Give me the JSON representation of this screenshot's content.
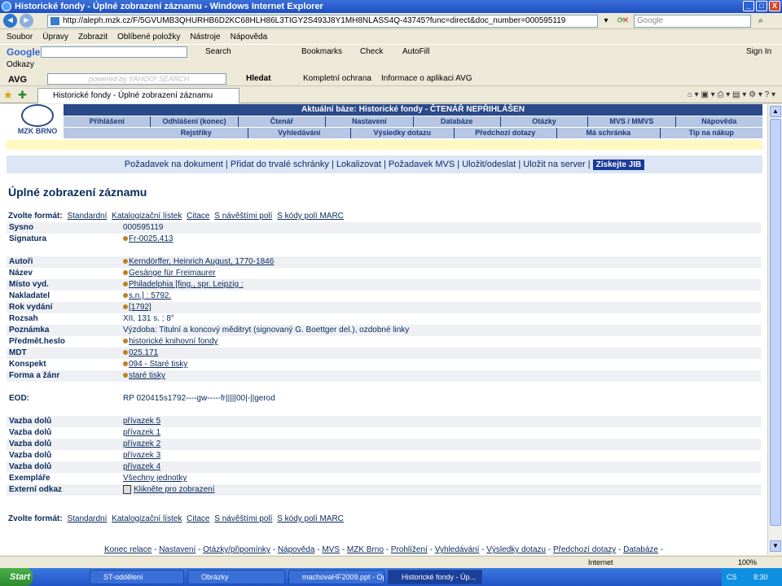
{
  "window": {
    "title": "Historické fondy - Úplné zobrazení záznamu - Windows Internet Explorer",
    "min": "_",
    "max": "□",
    "close": "X"
  },
  "address": {
    "url": "http://aleph.mzk.cz/F/5GVUMB3QHURHB6D2KC68HLH86L3TIGY2S493J8Y1MH8NLASS4Q-43745?func=direct&doc_number=000595119",
    "search_placeholder": "Google"
  },
  "menu": [
    "Soubor",
    "Úpravy",
    "Zobrazit",
    "Oblíbené položky",
    "Nástroje",
    "Nápověda"
  ],
  "google_toolbar": {
    "logo": "Google",
    "search_label": "Search",
    "bookmarks": "Bookmarks",
    "check": "Check",
    "autofill": "AutoFill",
    "signin": "Sign In"
  },
  "links_bar": "Odkazy",
  "avg_toolbar": {
    "logo": "AVG",
    "search_placeholder": "powered by YAHOO! SEARCH",
    "hledat": "Hledat",
    "kompletni": "Kompletní ochrana",
    "informace": "Informace o aplikaci AVG"
  },
  "tab": {
    "title": "Historické fondy - Úplné zobrazení záznamu"
  },
  "site": {
    "logo_text": "MZK BRNO",
    "bases_title": "Aktuální báze: Historické fondy - ČTENÁŘ NEPŘIHLÁŠEN",
    "nav1": [
      "Přihlášení",
      "Odhlášení (konec)",
      "Čtenář",
      "Nastavení",
      "Databáze",
      "Otázky",
      "MVS / MMVS",
      "Nápověda"
    ],
    "nav2": [
      "Rejstříky",
      "Vyhledávání",
      "Výsledky dotazu",
      "Předchozí dotazy",
      "Má schránka",
      "Tip na nákup"
    ],
    "actions": [
      "Požadavek na dokument",
      "Přidat do trvalé schránky",
      "Lokalizovat",
      "Požadavek MVS",
      "Uložit/odeslat",
      "Uložit na server"
    ],
    "jib": "Získejte JIB",
    "heading": "Úplné zobrazení záznamu",
    "format_label": "Zvolte formát:",
    "formats": [
      "Standardní",
      "Katalogizační lístek",
      "Citace",
      "S návěštími polí",
      "S kódy polí MARC"
    ]
  },
  "record": [
    {
      "label": "Sysno",
      "value": "000595119",
      "link": false,
      "dot": false
    },
    {
      "label": "Signatura",
      "value": "Fr-0025.413",
      "link": true,
      "dot": true
    },
    {
      "gap": true
    },
    {
      "label": "Autoři",
      "value": "Kerndörffer, Heinrich August, 1770-1846",
      "link": true,
      "dot": true
    },
    {
      "label": "Název",
      "value": "Gesänge für Freimaurer",
      "link": true,
      "dot": true
    },
    {
      "label": "Místo vyd.",
      "value": "Philadelphia [fing., spr. Leipzig :",
      "link": true,
      "dot": true
    },
    {
      "label": "Nakladatel",
      "value": "s.n.] : 5792.",
      "link": true,
      "dot": true
    },
    {
      "label": "Rok vydání",
      "value": "[1792]",
      "link": true,
      "dot": true
    },
    {
      "label": "Rozsah",
      "value": "XII, 131 s. ; 8°",
      "link": false,
      "dot": false
    },
    {
      "label": "Poznámka",
      "value": "Výzdoba: Titulní a koncový měditryt (signovaný G. Boettger del.), ozdobné linky",
      "link": false,
      "dot": false
    },
    {
      "label": "Předmět.heslo",
      "value": "historické knihovní fondy",
      "link": true,
      "dot": true
    },
    {
      "label": "MDT",
      "value": "025.171",
      "link": true,
      "dot": true
    },
    {
      "label": "Konspekt",
      "value": "094 - Staré tisky",
      "link": true,
      "dot": true
    },
    {
      "label": "Forma a žánr",
      "value": "staré tisky",
      "link": true,
      "dot": true
    },
    {
      "gap": true
    },
    {
      "label": "EOD:",
      "value": "RP 020415s1792----gw-----fr|||||00|-||gerod",
      "link": false,
      "dot": false
    },
    {
      "gap": true
    },
    {
      "label": "Vazba dolů",
      "value": "přívazek 5",
      "link": true,
      "dot": false
    },
    {
      "label": "Vazba dolů",
      "value": "přívazek 1",
      "link": true,
      "dot": false
    },
    {
      "label": "Vazba dolů",
      "value": "přívazek 2",
      "link": true,
      "dot": false
    },
    {
      "label": "Vazba dolů",
      "value": "přívazek 3",
      "link": true,
      "dot": false
    },
    {
      "label": "Vazba dolů",
      "value": "přívazek 4",
      "link": true,
      "dot": false
    },
    {
      "label": "Exempláře",
      "value": "Všechny jednotky",
      "link": true,
      "dot": false
    },
    {
      "label": "Externí odkaz",
      "value": "Klikněte pro zobrazení",
      "link": true,
      "dot": false,
      "icon": true
    }
  ],
  "footer_links": [
    "Konec relace",
    "Nastavení",
    "Otázky/připomínky",
    "Nápověda",
    "MVS",
    "MZK Brno",
    "Prohlížení",
    "Vyhledávání",
    "Výsledky dotazu",
    "Předchozí dotazy",
    "Databáze"
  ],
  "statusbar": {
    "zone": "Internet",
    "zoom": "100%"
  },
  "taskbar": {
    "start": "Start",
    "items": [
      "ST-oddělení",
      "Obrázky",
      "machovaHF2009.ppt - Op...",
      "Historické fondy - Úp..."
    ],
    "lang": "CS",
    "time": "8:30"
  }
}
